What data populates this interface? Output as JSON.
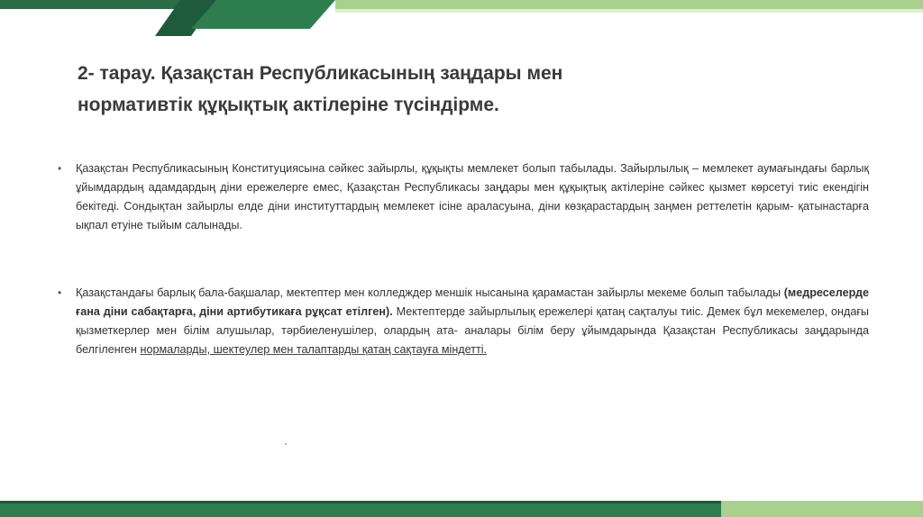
{
  "colors": {
    "dark_green": "#1e5a3c",
    "mid_green": "#2e7d4f",
    "light_green": "#a9d18e",
    "text": "#333333"
  },
  "slide": {
    "title_line1": "2- тарау. Қазақстан Республикасының заңдары мен",
    "title_line2": "нормативтік құқықтық актілеріне түсіндірме.",
    "paragraph1": {
      "bullet": "•",
      "text": "Қазақстан Республикасының Конституциясына сәйкес зайырлы, құқықты мемлекет болып табылады. Зайырлылық – мемлекет аумағындағы барлық ұйымдардың адамдардың діни ережелерге емес, Қазақстан Республикасы заңдары мен құқықтық актілеріне сәйкес қызмет көрсетуі тиіс екендігін бекітеді. Сондықтан зайырлы елде діни институттардың мемлекет ісіне араласуына, діни көзқарастардың заңмен реттелетін қарым- қатынастарға ықпал етуіне тыйым салынады."
    },
    "paragraph2": {
      "bullet": "•",
      "text_before": "Қазақстандағы барлық бала-бақшалар, мектептер мен колледждер меншік нысанына қарамастан зайырлы мекеме болып табылады ",
      "text_bold": "(медреселерде ғана діни сабақтарға, діни артибутикаға рұқсат етілген).",
      "text_after": " Мектептерде зайырлылық ережелері қатаң сақталуы тиіс. Демек бұл мекемелер, ондағы қызметкерлер мен білім алушылар, тәрбиеленушілер, олардың ата- аналары білім беру ұйымдарында Қазақстан Республикасы заңдарында белгіленген ",
      "text_underlined": "нормаларды, шектеулер мен талаптарды қатаң сақтауға міндетті."
    }
  }
}
